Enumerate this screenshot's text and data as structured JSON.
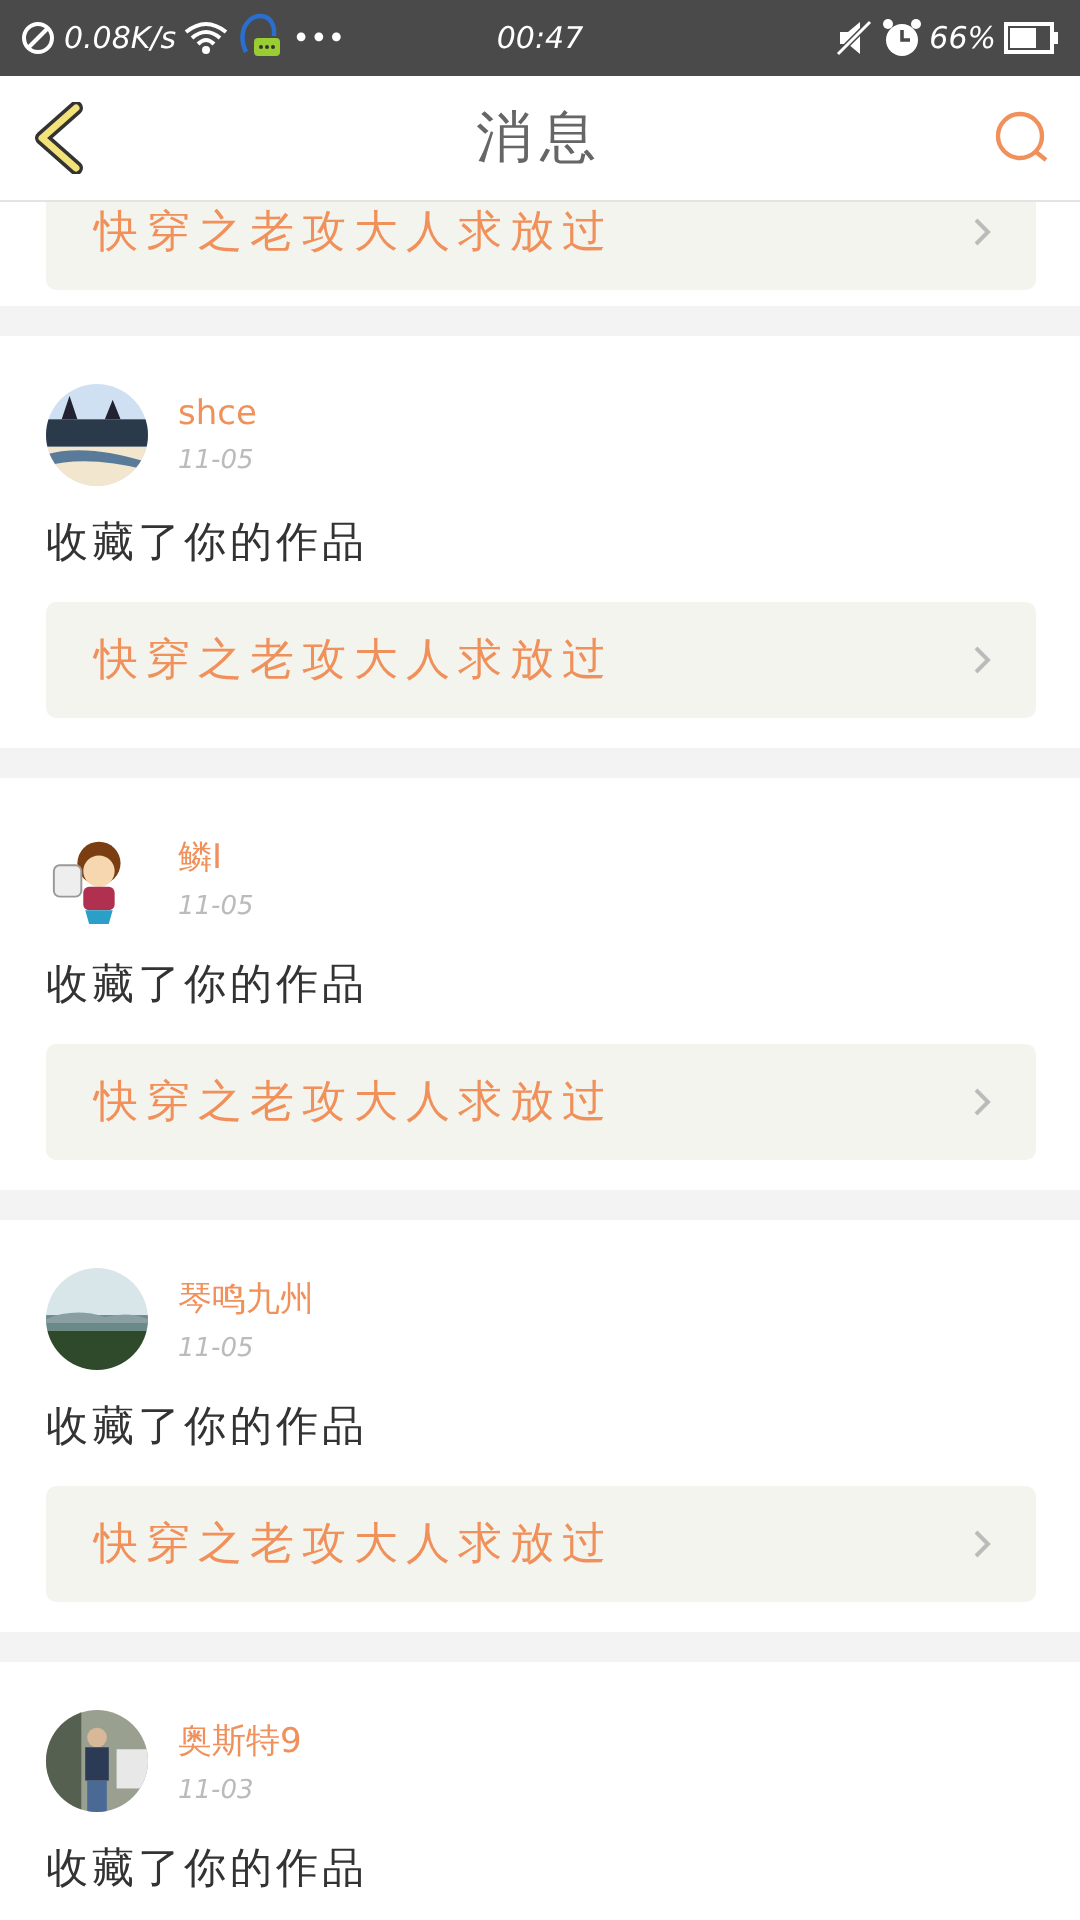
{
  "status_bar": {
    "speed": "0.08K/s",
    "more": "•••",
    "time": "00:47",
    "battery": "66%"
  },
  "header": {
    "title": "消息"
  },
  "messages": [
    {
      "work": "快穿之老攻大人求放过"
    },
    {
      "user": "shce",
      "date": "11-05",
      "text": "收藏了你的作品",
      "work": "快穿之老攻大人求放过"
    },
    {
      "user": "鳞I",
      "date": "11-05",
      "text": "收藏了你的作品",
      "work": "快穿之老攻大人求放过"
    },
    {
      "user": "琴鸣九州",
      "date": "11-05",
      "text": "收藏了你的作品",
      "work": "快穿之老攻大人求放过"
    },
    {
      "user": "奥斯特9",
      "date": "11-03",
      "text": "收藏了你的作品"
    }
  ]
}
